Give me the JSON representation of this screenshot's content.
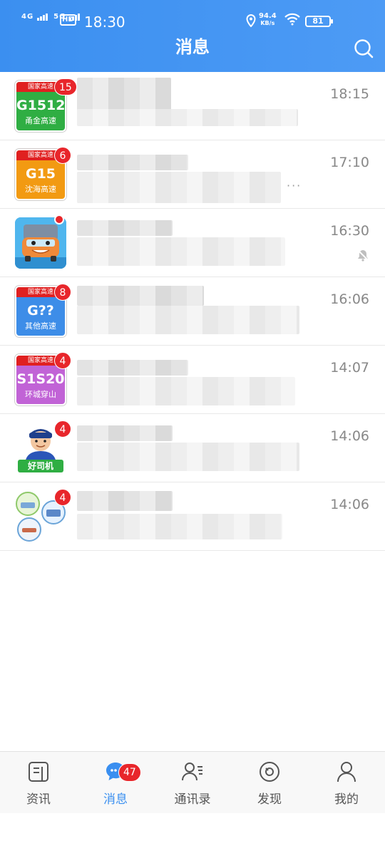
{
  "status_bar": {
    "network_1": "4G",
    "network_2": "5G",
    "hd": "HD",
    "time": "18:30",
    "speed_value": "94.4",
    "speed_unit": "KB/s",
    "battery": "81"
  },
  "header": {
    "title": "消息"
  },
  "conversations": [
    {
      "time": "18:15",
      "avatar": {
        "kind": "highway",
        "top": "国家高速",
        "code": "G1512",
        "name": "甬金高速",
        "color": "#2fae43"
      },
      "badge": "15"
    },
    {
      "time": "17:10",
      "avatar": {
        "kind": "highway",
        "top": "国家高速",
        "code": "G15",
        "name": "沈海高速",
        "color": "#f29a12"
      },
      "badge": "6"
    },
    {
      "time": "16:30",
      "avatar": {
        "kind": "truck"
      },
      "badge": ""
    },
    {
      "time": "16:06",
      "avatar": {
        "kind": "highway",
        "top": "国家高速",
        "code": "G??",
        "name": "其他高速",
        "color": "#3d8de8"
      },
      "badge": "8"
    },
    {
      "time": "14:07",
      "avatar": {
        "kind": "highway",
        "top": "国家高速",
        "code": "S1S20",
        "name": "环城穿山",
        "color": "#c163d6"
      },
      "badge": "4"
    },
    {
      "time": "14:06",
      "avatar": {
        "kind": "driver",
        "label": "好司机"
      },
      "badge": "4"
    },
    {
      "time": "14:06",
      "avatar": {
        "kind": "group"
      },
      "badge": "4"
    }
  ],
  "tabbar": {
    "tabs": [
      {
        "label": "资讯"
      },
      {
        "label": "消息",
        "badge": "47"
      },
      {
        "label": "通讯录"
      },
      {
        "label": "发现"
      },
      {
        "label": "我的"
      }
    ]
  },
  "colors": {
    "primary": "#3a8ff0",
    "badge": "#e8262b"
  }
}
